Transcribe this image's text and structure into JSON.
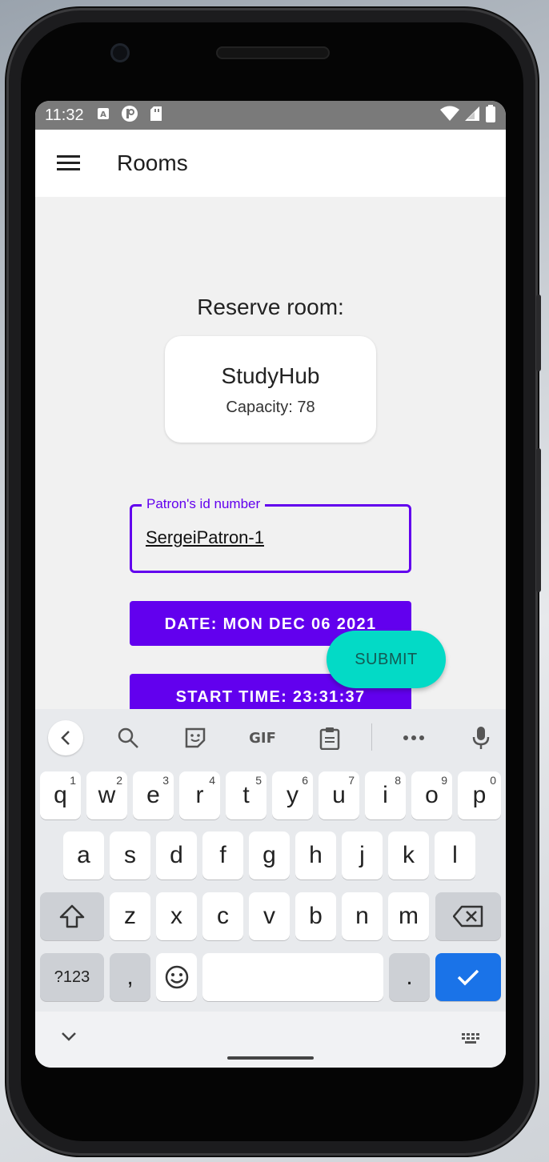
{
  "status_bar": {
    "time": "11:32",
    "left_icons": [
      "a-icon",
      "p-icon",
      "sd-card-icon"
    ],
    "right_icons": [
      "wifi-icon",
      "signal-icon",
      "battery-icon"
    ]
  },
  "app_bar": {
    "title": "Rooms",
    "menu_icon": "hamburger-menu-icon"
  },
  "reserve": {
    "heading": "Reserve room:",
    "room_name": "StudyHub",
    "room_capacity": "Capacity: 78"
  },
  "patron_field": {
    "label": "Patron's id number",
    "value": "SergeiPatron-1"
  },
  "buttons": {
    "date": "DATE: MON DEC 06 2021",
    "start_time": "START TIME: 23:31:37",
    "submit": "SUBMIT"
  },
  "colors": {
    "primary": "#6200ee",
    "fab": "#03dac6",
    "keyboard_action": "#1a73e8"
  },
  "keyboard": {
    "toolbar": [
      "back-icon",
      "search-icon",
      "sticker-icon",
      "GIF",
      "clipboard-icon",
      "more-icon",
      "microphone-icon"
    ],
    "row1": [
      {
        "key": "q",
        "num": "1"
      },
      {
        "key": "w",
        "num": "2"
      },
      {
        "key": "e",
        "num": "3"
      },
      {
        "key": "r",
        "num": "4"
      },
      {
        "key": "t",
        "num": "5"
      },
      {
        "key": "y",
        "num": "6"
      },
      {
        "key": "u",
        "num": "7"
      },
      {
        "key": "i",
        "num": "8"
      },
      {
        "key": "o",
        "num": "9"
      },
      {
        "key": "p",
        "num": "0"
      }
    ],
    "row2": [
      "a",
      "s",
      "d",
      "f",
      "g",
      "h",
      "j",
      "k",
      "l"
    ],
    "row3": [
      "z",
      "x",
      "c",
      "v",
      "b",
      "n",
      "m"
    ],
    "bottom": {
      "symbols": "?123",
      "comma": ",",
      "period": "."
    }
  }
}
